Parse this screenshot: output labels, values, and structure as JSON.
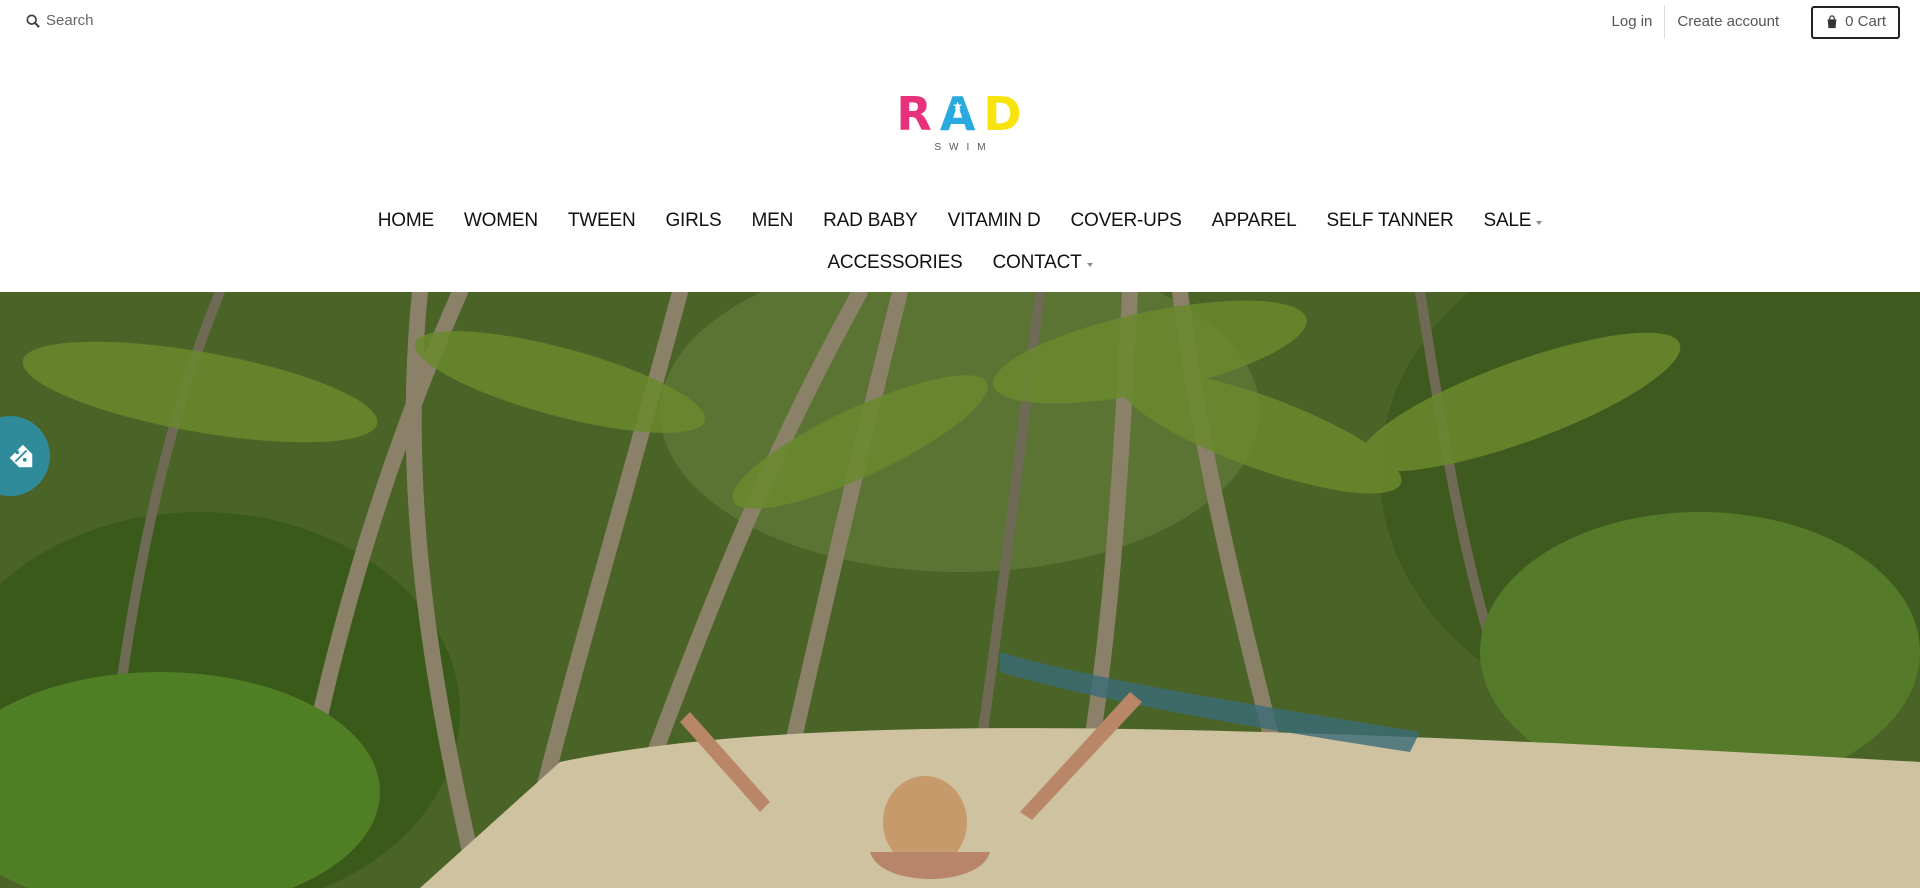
{
  "header": {
    "search_placeholder": "Search",
    "login_label": "Log in",
    "create_account_label": "Create account",
    "cart_label": "0 Cart"
  },
  "logo": {
    "letters": [
      "R",
      "A",
      "D"
    ],
    "subtitle": "SWIM",
    "colors": [
      "#e8317a",
      "#2aa9df",
      "#f6e40c"
    ]
  },
  "nav": {
    "row1": [
      {
        "label": "HOME"
      },
      {
        "label": "WOMEN"
      },
      {
        "label": "TWEEN"
      },
      {
        "label": "GIRLS"
      },
      {
        "label": "MEN"
      },
      {
        "label": "RAD BABY"
      },
      {
        "label": "VITAMIN D"
      },
      {
        "label": "COVER-UPS"
      },
      {
        "label": "APPAREL"
      },
      {
        "label": "SELF TANNER"
      },
      {
        "label": "SALE"
      }
    ],
    "row2": [
      {
        "label": "ACCESSORIES"
      },
      {
        "label": "CONTACT"
      }
    ]
  },
  "hero": {
    "description_icon": "beach-palm-photo"
  },
  "discount_widget": {
    "icon": "percent-tag-icon",
    "color": "#2f8b9a"
  }
}
